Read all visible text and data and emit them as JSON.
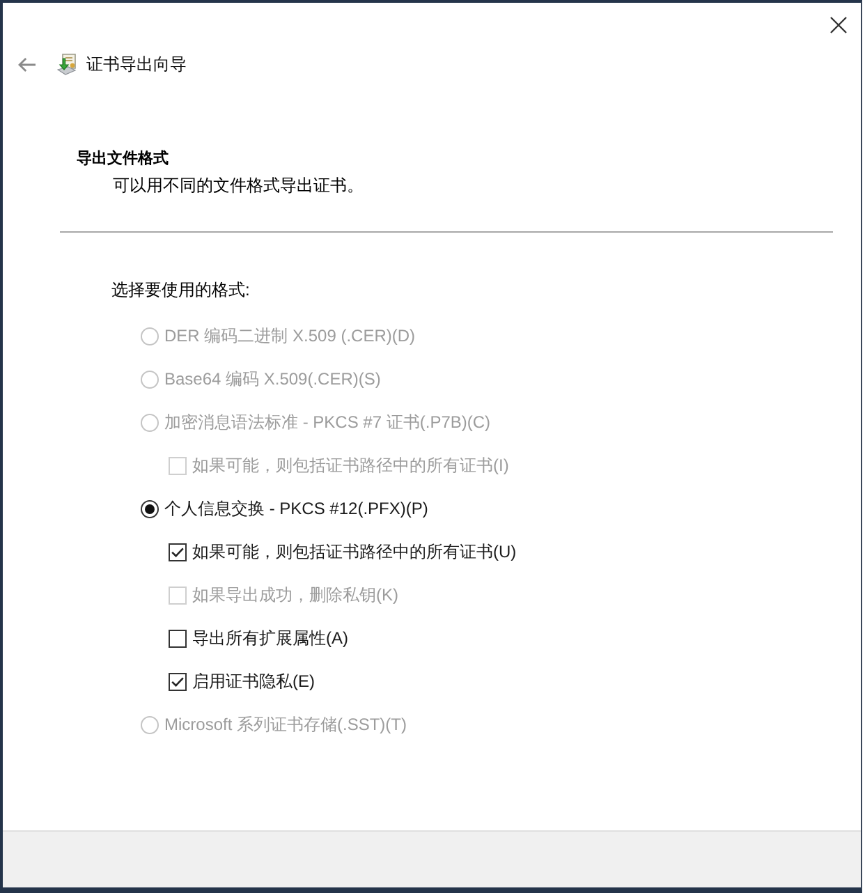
{
  "window": {
    "title": "证书导出向导"
  },
  "header": {
    "title": "导出文件格式",
    "description": "可以用不同的文件格式导出证书。"
  },
  "format_prompt": "选择要使用的格式:",
  "options": [
    {
      "kind": "radio",
      "label": "DER 编码二进制 X.509 (.CER)(D)",
      "selected": false,
      "disabled": true
    },
    {
      "kind": "radio",
      "label": "Base64 编码 X.509(.CER)(S)",
      "selected": false,
      "disabled": true
    },
    {
      "kind": "radio",
      "label": "加密消息语法标准 - PKCS #7 证书(.P7B)(C)",
      "selected": false,
      "disabled": true,
      "children": [
        {
          "kind": "checkbox",
          "label": "如果可能，则包括证书路径中的所有证书(I)",
          "checked": false,
          "disabled": true
        }
      ]
    },
    {
      "kind": "radio",
      "label": "个人信息交换 - PKCS #12(.PFX)(P)",
      "selected": true,
      "disabled": false,
      "children": [
        {
          "kind": "checkbox",
          "label": "如果可能，则包括证书路径中的所有证书(U)",
          "checked": true,
          "disabled": false
        },
        {
          "kind": "checkbox",
          "label": "如果导出成功，删除私钥(K)",
          "checked": false,
          "disabled": true
        },
        {
          "kind": "checkbox",
          "label": "导出所有扩展属性(A)",
          "checked": false,
          "disabled": false
        },
        {
          "kind": "checkbox",
          "label": "启用证书隐私(E)",
          "checked": true,
          "disabled": false
        }
      ]
    },
    {
      "kind": "radio",
      "label": "Microsoft 系列证书存储(.SST)(T)",
      "selected": false,
      "disabled": true
    }
  ]
}
